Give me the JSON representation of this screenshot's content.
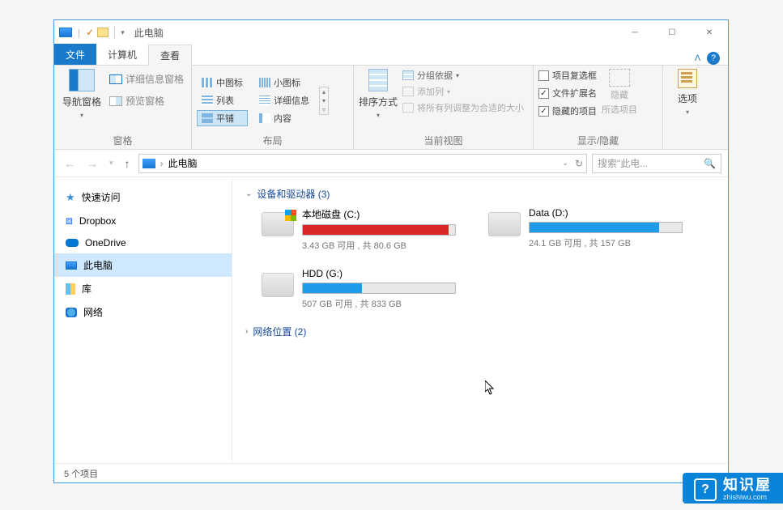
{
  "title": "此电脑",
  "tabs": {
    "file": "文件",
    "computer": "计算机",
    "view": "查看"
  },
  "ribbon": {
    "panes": {
      "nav": "导航窗格",
      "detail": "详细信息窗格",
      "preview": "预览窗格",
      "group": "窗格"
    },
    "layout": {
      "medium": "中图标",
      "small": "小图标",
      "list": "列表",
      "details": "详细信息",
      "tiles": "平铺",
      "content": "内容",
      "group": "布局"
    },
    "currentview": {
      "sort": "排序方式",
      "groupby": "分组依据",
      "addcol": "添加列",
      "sizeall": "将所有列调整为合适的大小",
      "group": "当前视图"
    },
    "showhide": {
      "checkboxes": "项目复选框",
      "ext": "文件扩展名",
      "hidden": "隐藏的项目",
      "hidebtn": "隐藏",
      "hidebtn2": "所选项目",
      "group": "显示/隐藏"
    },
    "options": "选项"
  },
  "address": {
    "path": "此电脑",
    "search_placeholder": "搜索\"此电..."
  },
  "tree": {
    "quick": "快速访问",
    "dropbox": "Dropbox",
    "onedrive": "OneDrive",
    "thispc": "此电脑",
    "lib": "库",
    "network": "网络"
  },
  "sections": {
    "drives": "设备和驱动器 (3)",
    "netloc": "网络位置 (2)"
  },
  "drives": [
    {
      "name": "本地磁盘 (C:)",
      "detail": "3.43 GB 可用 , 共 80.6 GB",
      "pct": 96,
      "color": "#d92626",
      "os": true
    },
    {
      "name": "Data (D:)",
      "detail": "24.1 GB 可用 , 共 157 GB",
      "pct": 85,
      "color": "#1e9be9",
      "os": false
    },
    {
      "name": "HDD (G:)",
      "detail": "507 GB 可用 , 共 833 GB",
      "pct": 39,
      "color": "#1e9be9",
      "os": false
    }
  ],
  "status": "5 个项目",
  "watermark": {
    "big": "知识屋",
    "small": "zhishiwu.com"
  }
}
